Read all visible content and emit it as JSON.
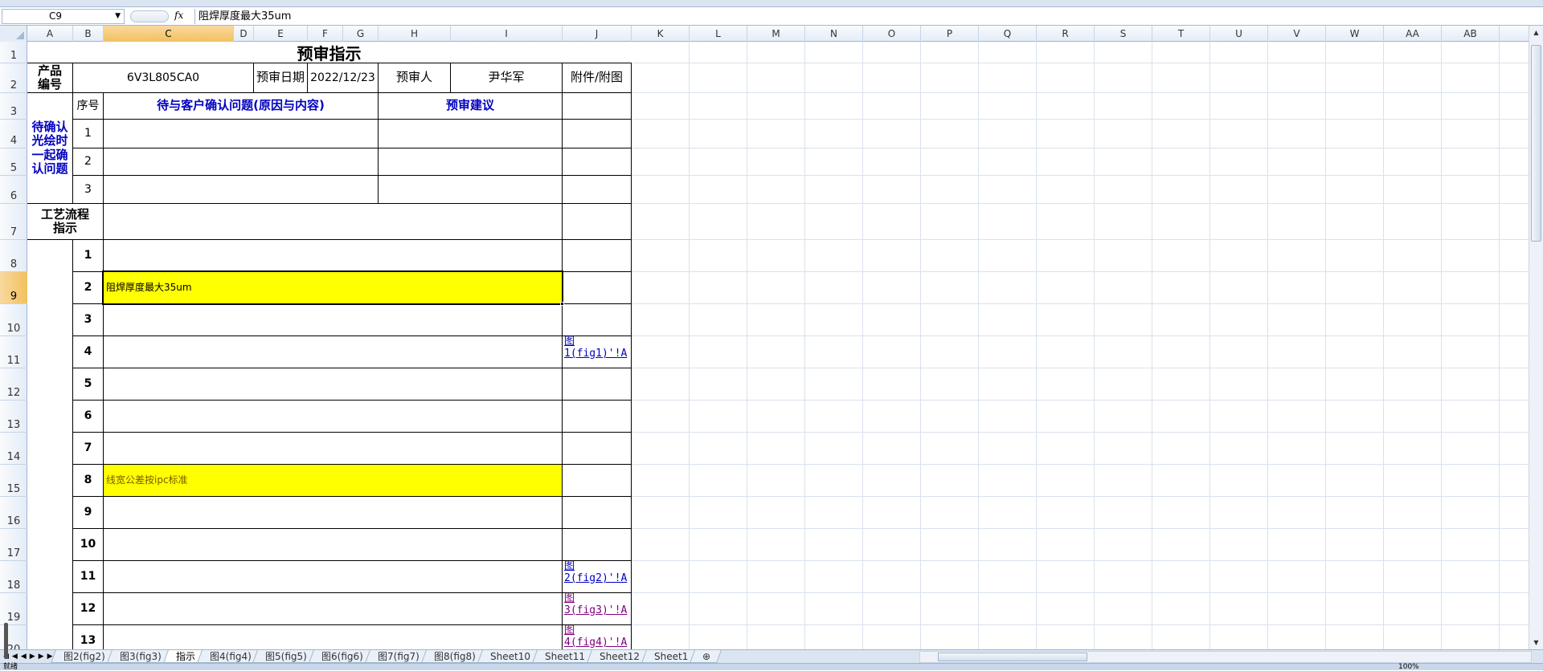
{
  "formula_bar": {
    "cell_ref": "C9",
    "fx_label": "fx",
    "content": "阻焊厚度最大35um"
  },
  "columns": [
    "A",
    "B",
    "C",
    "D",
    "E",
    "F",
    "G",
    "H",
    "I",
    "J",
    "K",
    "L",
    "M",
    "N",
    "O",
    "P",
    "Q",
    "R",
    "S",
    "T",
    "U",
    "V",
    "W",
    "AA",
    "AB"
  ],
  "selected_column": "C",
  "rows": [
    "1",
    "2",
    "3",
    "4",
    "5",
    "6",
    "7",
    "8",
    "9",
    "10",
    "11",
    "12",
    "13",
    "14",
    "15",
    "16",
    "17",
    "18",
    "19",
    "20"
  ],
  "selected_row": "9",
  "sheet": {
    "title": "预审指示",
    "product_label": "产品\n编号",
    "product_value": "6V3L805CA0",
    "review_date_label": "预审日期",
    "review_date_value": "2022/12/23",
    "reviewer_label": "预审人",
    "reviewer_value": "尹华军",
    "attachment_label": "附件/附图",
    "seq_label": "序号",
    "confirm_section_label": "待确认\n光绘时\n一起确\n认问题",
    "issue_header": "待与客户确认问题(原因与内容)",
    "advice_header": "预审建议",
    "confirm_rows": [
      "1",
      "2",
      "3"
    ],
    "process_label": "工艺流程\n指示",
    "steps": [
      {
        "no": "1",
        "text": "",
        "link": ""
      },
      {
        "no": "2",
        "text": "阻焊厚度最大35um",
        "link": ""
      },
      {
        "no": "3",
        "text": "",
        "link": ""
      },
      {
        "no": "4",
        "text": "",
        "link": "图\n1(fig1)'!A"
      },
      {
        "no": "5",
        "text": "",
        "link": ""
      },
      {
        "no": "6",
        "text": "",
        "link": ""
      },
      {
        "no": "7",
        "text": "",
        "link": ""
      },
      {
        "no": "8",
        "text": "线宽公差按ipc标准",
        "link": ""
      },
      {
        "no": "9",
        "text": "",
        "link": ""
      },
      {
        "no": "10",
        "text": "",
        "link": ""
      },
      {
        "no": "11",
        "text": "",
        "link": "图\n2(fig2)'!A"
      },
      {
        "no": "12",
        "text": "",
        "link": "图\n3(fig3)'!A"
      },
      {
        "no": "13",
        "text": "",
        "link": "图\n4(fig4)'!A"
      }
    ]
  },
  "tabs": [
    "图2(fig2)",
    "图3(fig3)",
    "指示",
    "图4(fig4)",
    "图5(fig5)",
    "图6(fig6)",
    "图7(fig7)",
    "图8(fig8)",
    "Sheet10",
    "Sheet11",
    "Sheet12",
    "Sheet1"
  ],
  "active_tab": "指示",
  "status": {
    "left": "就绪",
    "zoom": "100%"
  }
}
